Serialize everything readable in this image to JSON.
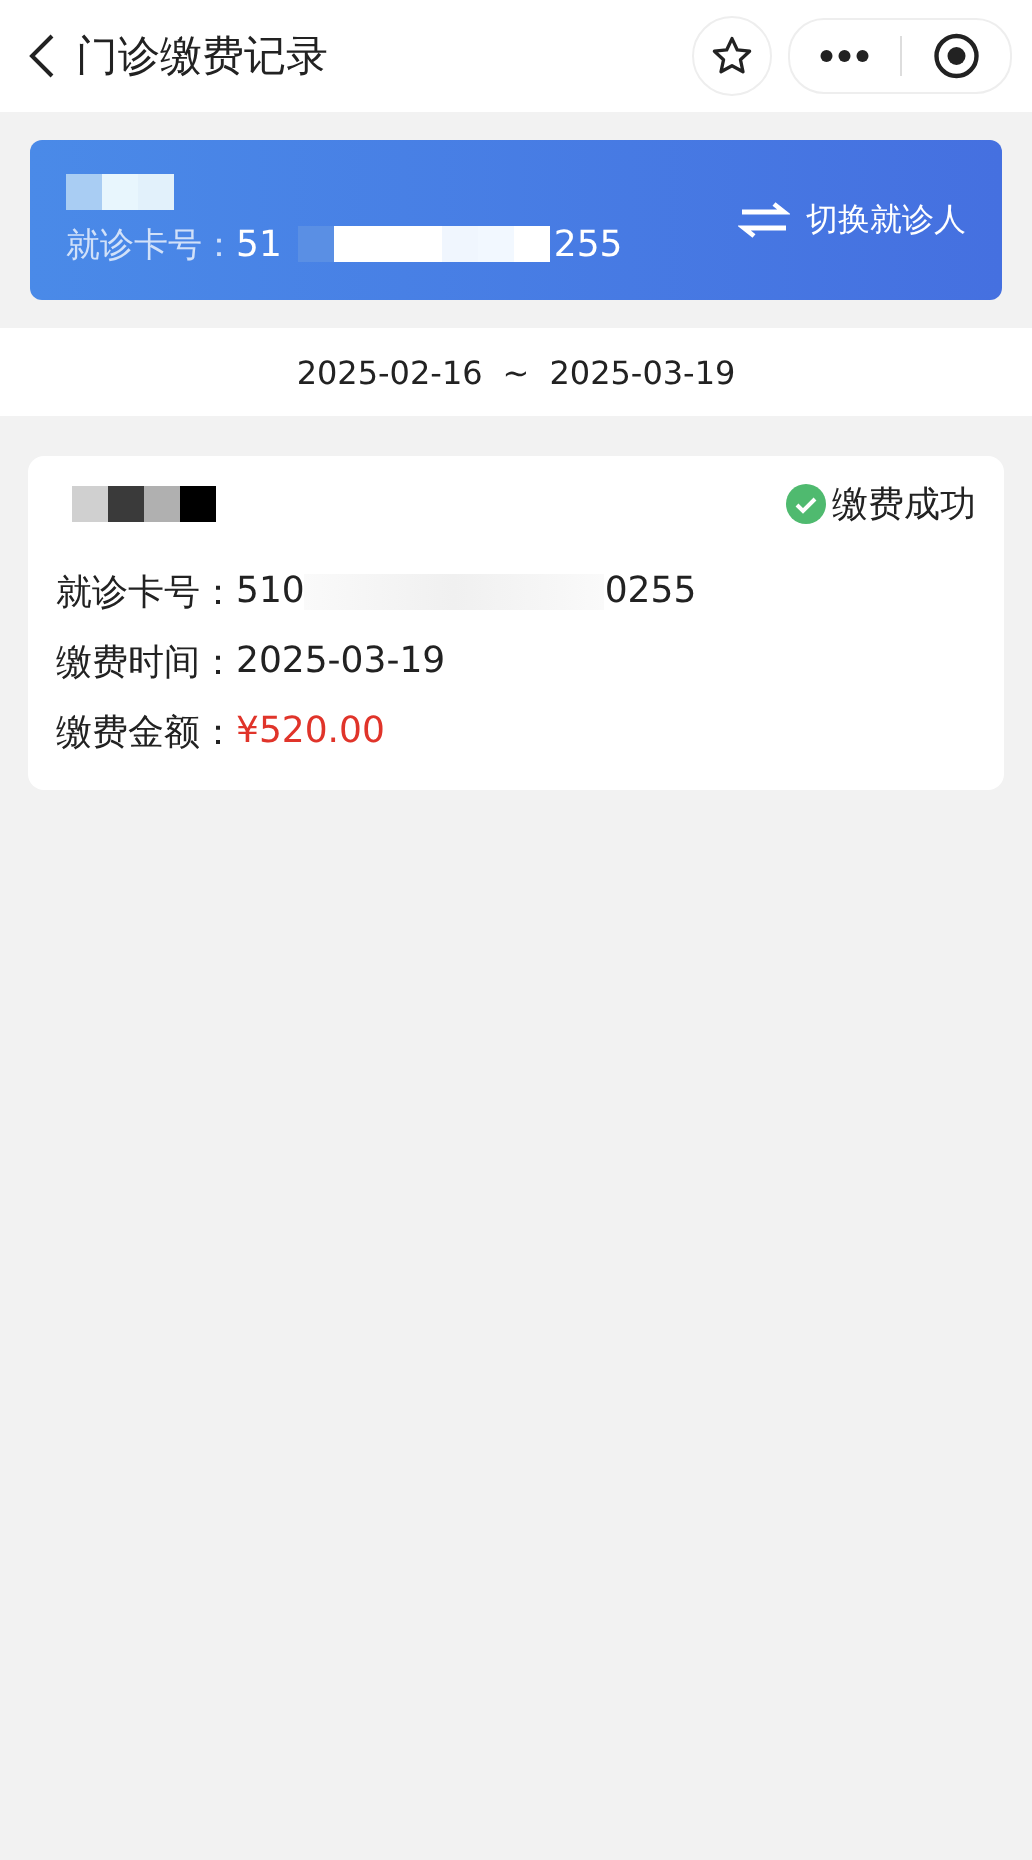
{
  "nav": {
    "title": "门诊缴费记录"
  },
  "banner": {
    "card_label": "就诊卡号：",
    "card_number_parts": [
      "51",
      "255"
    ],
    "switch_label": "切换就诊人"
  },
  "date_range": {
    "start": "2025-02-16",
    "separator": "~",
    "end": "2025-03-19"
  },
  "records": [
    {
      "status": "缴费成功",
      "paid": true,
      "fields": [
        {
          "label": "就诊卡号：",
          "value_parts": [
            "510",
            "0255"
          ],
          "kind": "masked"
        },
        {
          "label": "缴费时间：",
          "value_parts": [
            "2025-03-19"
          ],
          "kind": "plain"
        },
        {
          "label": "缴费金额：",
          "value_parts": [
            "¥520.00"
          ],
          "kind": "amount"
        }
      ]
    }
  ]
}
